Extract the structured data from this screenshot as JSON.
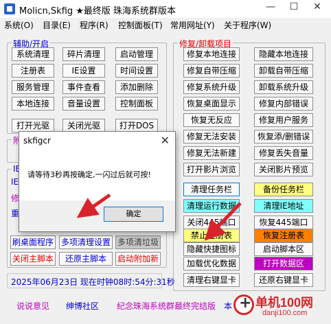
{
  "window": {
    "title": "Molicn,Skfig ★最终版 珠海系统群版本",
    "minimize": "—",
    "maximize": "☐",
    "close": "✕"
  },
  "menu": [
    "系统(O)",
    "目录(E)",
    "程序(R)",
    "控制面板(T)",
    "常用网址(Y)",
    "关于程序(W)"
  ],
  "left_group": {
    "title": "辅助/开启",
    "buttons": [
      "系统清理",
      "碎片清理",
      "启动管理",
      "注册表",
      "IE设置",
      "时间设置",
      "服务管理",
      "事件查看",
      "添加删除",
      "本地连接",
      "音量设置",
      "控制面板",
      "打开光驱",
      "关闭光驱",
      "打开DOS"
    ]
  },
  "left_partial": {
    "second_title": "附",
    "third_title": "IE",
    "row_edge_1": "IE",
    "row_edge_2": "修",
    "row_edge_3": "重",
    "row_btn_1": "刷桌面程序",
    "row_btn_2": "多项清理设置",
    "row_btn_3": "多项清垃圾",
    "row_btn_4": "关闭主脚本",
    "row_btn_5": "还原主脚本",
    "row_btn_6": "启动附加新"
  },
  "right_group": {
    "title": "修复/卸载项目",
    "buttons": [
      "修复本地连接",
      "隐藏本地连接",
      "修复自带压缩",
      "卸载自带压缩",
      "修复系统升级",
      "卸载系统升级",
      "恢复桌面显示",
      "修复内部错误",
      "恢复无反应",
      "修复用户服务",
      "修复无法安装",
      "恢复添/删错误",
      "修复无法新建",
      "修复丢失音量",
      "打开影片浏览",
      "关闭影片预览",
      "清理任务栏",
      "备份任务栏",
      "清理运行数据",
      "清理IE地址",
      "关闭445端口",
      "恢复445端口",
      "禁止注册表",
      "恢复注册表",
      "隐藏快捷图标",
      "启动脚本区",
      "加载优化数据",
      "打开数据区",
      "清理右键显卡",
      "还原右键显卡"
    ]
  },
  "status": {
    "time": "2025年06月23日 现在时钟08时:54分:31秒"
  },
  "footer": {
    "link1": "说说意见",
    "link2": "绅博社区",
    "link3": "纪念珠海系统群最终完结版",
    "link4": "本"
  },
  "dialog": {
    "title": "skfigcr",
    "close": "✕",
    "message": "请等待3秒再按确定,一闪过后就可按!",
    "ok_label": "确定"
  },
  "watermark": {
    "text": "单机100网",
    "sub": "danji100.com"
  },
  "colors": {
    "accent_blue": "#0000cc",
    "red": "#e00000",
    "yellow": "#ffff80",
    "cyan": "#80ffff",
    "orange": "#ff8000",
    "purple": "#c000c0",
    "arrow_red": "#d9232c"
  }
}
